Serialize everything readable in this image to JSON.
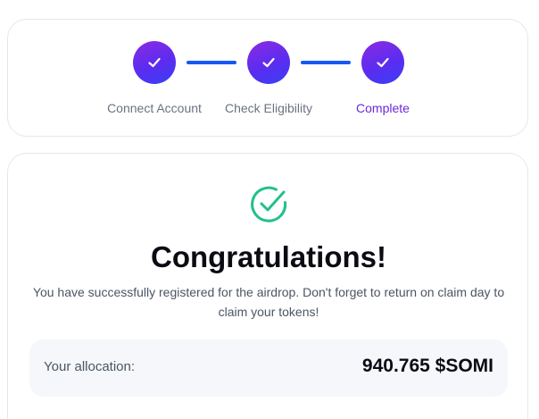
{
  "steps": [
    {
      "label": "Connect Account",
      "state": "done",
      "icon": "check-icon"
    },
    {
      "label": "Check Eligibility",
      "state": "done",
      "icon": "check-icon"
    },
    {
      "label": "Complete",
      "state": "done",
      "icon": "check-icon"
    }
  ],
  "colors": {
    "step_gradient_start": "#8a2be2",
    "step_gradient_end": "#3a3ff5",
    "connector": "#1559f5",
    "active_label": "#6d28d9",
    "inactive_label": "#6b7280",
    "success": "#22c08a"
  },
  "result": {
    "icon": "check-circle-icon",
    "title": "Congratulations!",
    "message_line1": "You have successfully registered for the airdrop. Don't forget to return on claim day to",
    "message_line2": "claim your tokens!",
    "allocation_label": "Your allocation:",
    "allocation_value": "940.765 $SOMI"
  }
}
